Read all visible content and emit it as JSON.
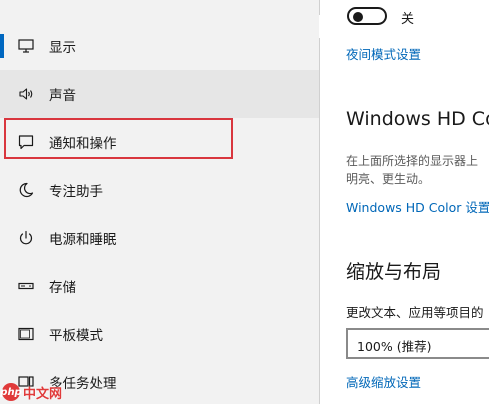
{
  "sidebar": {
    "items": [
      {
        "label": "显示",
        "icon": "monitor-icon",
        "selected": true
      },
      {
        "label": "声音",
        "icon": "speaker-icon"
      },
      {
        "label": "通知和操作",
        "icon": "notification-icon"
      },
      {
        "label": "专注助手",
        "icon": "moon-icon"
      },
      {
        "label": "电源和睡眠",
        "icon": "power-icon"
      },
      {
        "label": "存储",
        "icon": "storage-icon"
      },
      {
        "label": "平板模式",
        "icon": "tablet-icon"
      },
      {
        "label": "多任务处理",
        "icon": "multitask-icon"
      }
    ]
  },
  "content": {
    "night_light": {
      "toggle_state": "关",
      "settings_link": "夜间模式设置"
    },
    "hd_color": {
      "title": "Windows HD Co",
      "desc_line1": "在上面所选择的显示器上",
      "desc_line2": "明亮、更生动。",
      "link": "Windows HD Color 设置"
    },
    "scale_layout": {
      "title": "缩放与布局",
      "label": "更改文本、应用等项目的",
      "dropdown_value": "100% (推荐)",
      "advanced_link": "高级缩放设置"
    }
  },
  "watermark": {
    "logo_text": "php",
    "site": "中文网"
  },
  "colors": {
    "accent": "#0067c0",
    "link": "#0067b8",
    "highlight_box": "#d9363e",
    "sidebar_bg": "#f2f2f2"
  }
}
